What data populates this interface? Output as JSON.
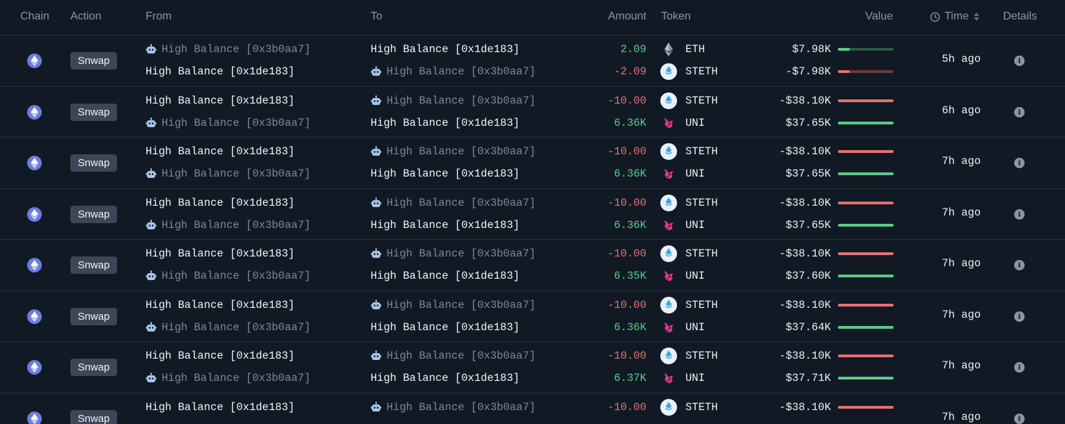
{
  "columns": {
    "chain": "Chain",
    "action": "Action",
    "from": "From",
    "to": "To",
    "amount": "Amount",
    "token": "Token",
    "value": "Value",
    "time": "Time",
    "details": "Details"
  },
  "colors": {
    "positive": "#5bcb8a",
    "negative": "#e77171",
    "eth_chain": "#6a7ee0"
  },
  "rows": [
    {
      "action": "Snwap",
      "time": "5h ago",
      "legs": [
        {
          "from": "High Balance [0x3b0aa7]",
          "from_icon": "bot-icon",
          "to": "High Balance [0x1de183]",
          "to_icon": "",
          "amount": "2.09",
          "sign": "pos",
          "token": "ETH",
          "token_icon": "eth-icon",
          "value": "$7.98K",
          "value_ratio": 0.21
        },
        {
          "from": "High Balance [0x1de183]",
          "from_icon": "",
          "to": "High Balance [0x3b0aa7]",
          "to_icon": "bot-icon",
          "amount": "-2.09",
          "sign": "neg",
          "token": "STETH",
          "token_icon": "steth-icon",
          "value": "-$7.98K",
          "value_ratio": 0.21
        }
      ]
    },
    {
      "action": "Snwap",
      "time": "6h ago",
      "legs": [
        {
          "from": "High Balance [0x1de183]",
          "from_icon": "",
          "to": "High Balance [0x3b0aa7]",
          "to_icon": "bot-icon",
          "amount": "-10.00",
          "sign": "neg",
          "token": "STETH",
          "token_icon": "steth-icon",
          "value": "-$38.10K",
          "value_ratio": 1.0
        },
        {
          "from": "High Balance [0x3b0aa7]",
          "from_icon": "bot-icon",
          "to": "High Balance [0x1de183]",
          "to_icon": "",
          "amount": "6.36K",
          "sign": "pos",
          "token": "UNI",
          "token_icon": "uni-icon",
          "value": "$37.65K",
          "value_ratio": 1.0
        }
      ]
    },
    {
      "action": "Snwap",
      "time": "7h ago",
      "legs": [
        {
          "from": "High Balance [0x1de183]",
          "from_icon": "",
          "to": "High Balance [0x3b0aa7]",
          "to_icon": "bot-icon",
          "amount": "-10.00",
          "sign": "neg",
          "token": "STETH",
          "token_icon": "steth-icon",
          "value": "-$38.10K",
          "value_ratio": 1.0
        },
        {
          "from": "High Balance [0x3b0aa7]",
          "from_icon": "bot-icon",
          "to": "High Balance [0x1de183]",
          "to_icon": "",
          "amount": "6.36K",
          "sign": "pos",
          "token": "UNI",
          "token_icon": "uni-icon",
          "value": "$37.65K",
          "value_ratio": 1.0
        }
      ]
    },
    {
      "action": "Snwap",
      "time": "7h ago",
      "legs": [
        {
          "from": "High Balance [0x1de183]",
          "from_icon": "",
          "to": "High Balance [0x3b0aa7]",
          "to_icon": "bot-icon",
          "amount": "-10.00",
          "sign": "neg",
          "token": "STETH",
          "token_icon": "steth-icon",
          "value": "-$38.10K",
          "value_ratio": 1.0
        },
        {
          "from": "High Balance [0x3b0aa7]",
          "from_icon": "bot-icon",
          "to": "High Balance [0x1de183]",
          "to_icon": "",
          "amount": "6.36K",
          "sign": "pos",
          "token": "UNI",
          "token_icon": "uni-icon",
          "value": "$37.65K",
          "value_ratio": 1.0
        }
      ]
    },
    {
      "action": "Snwap",
      "time": "7h ago",
      "legs": [
        {
          "from": "High Balance [0x1de183]",
          "from_icon": "",
          "to": "High Balance [0x3b0aa7]",
          "to_icon": "bot-icon",
          "amount": "-10.00",
          "sign": "neg",
          "token": "STETH",
          "token_icon": "steth-icon",
          "value": "-$38.10K",
          "value_ratio": 1.0
        },
        {
          "from": "High Balance [0x3b0aa7]",
          "from_icon": "bot-icon",
          "to": "High Balance [0x1de183]",
          "to_icon": "",
          "amount": "6.35K",
          "sign": "pos",
          "token": "UNI",
          "token_icon": "uni-icon",
          "value": "$37.60K",
          "value_ratio": 1.0
        }
      ]
    },
    {
      "action": "Snwap",
      "time": "7h ago",
      "legs": [
        {
          "from": "High Balance [0x1de183]",
          "from_icon": "",
          "to": "High Balance [0x3b0aa7]",
          "to_icon": "bot-icon",
          "amount": "-10.00",
          "sign": "neg",
          "token": "STETH",
          "token_icon": "steth-icon",
          "value": "-$38.10K",
          "value_ratio": 1.0
        },
        {
          "from": "High Balance [0x3b0aa7]",
          "from_icon": "bot-icon",
          "to": "High Balance [0x1de183]",
          "to_icon": "",
          "amount": "6.36K",
          "sign": "pos",
          "token": "UNI",
          "token_icon": "uni-icon",
          "value": "$37.64K",
          "value_ratio": 1.0
        }
      ]
    },
    {
      "action": "Snwap",
      "time": "7h ago",
      "legs": [
        {
          "from": "High Balance [0x1de183]",
          "from_icon": "",
          "to": "High Balance [0x3b0aa7]",
          "to_icon": "bot-icon",
          "amount": "-10.00",
          "sign": "neg",
          "token": "STETH",
          "token_icon": "steth-icon",
          "value": "-$38.10K",
          "value_ratio": 1.0
        },
        {
          "from": "High Balance [0x3b0aa7]",
          "from_icon": "bot-icon",
          "to": "High Balance [0x1de183]",
          "to_icon": "",
          "amount": "6.37K",
          "sign": "pos",
          "token": "UNI",
          "token_icon": "uni-icon",
          "value": "$37.71K",
          "value_ratio": 1.0
        }
      ]
    },
    {
      "action": "Snwap",
      "time": "7h ago",
      "legs": [
        {
          "from": "High Balance [0x1de183]",
          "from_icon": "",
          "to": "High Balance [0x3b0aa7]",
          "to_icon": "bot-icon",
          "amount": "-10.00",
          "sign": "neg",
          "token": "STETH",
          "token_icon": "steth-icon",
          "value": "-$38.10K",
          "value_ratio": 1.0
        }
      ]
    }
  ]
}
